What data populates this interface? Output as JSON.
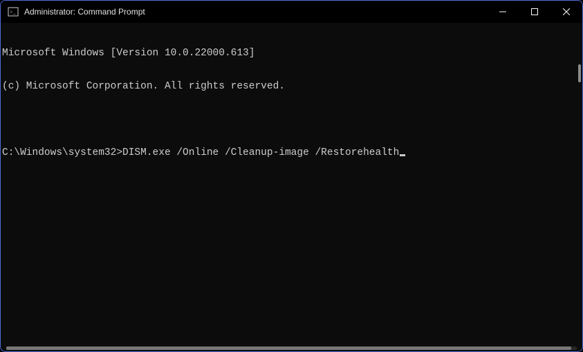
{
  "window": {
    "title": "Administrator: Command Prompt"
  },
  "terminal": {
    "line1": "Microsoft Windows [Version 10.0.22000.613]",
    "line2": "(c) Microsoft Corporation. All rights reserved.",
    "blank": "",
    "prompt": "C:\\Windows\\system32>",
    "command": "DISM.exe /Online /Cleanup-image /Restorehealth"
  }
}
